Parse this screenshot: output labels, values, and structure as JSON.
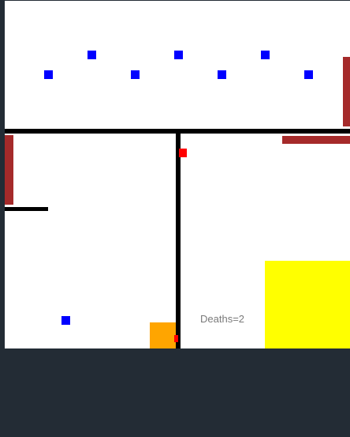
{
  "game": {
    "deaths_text": "Deaths=2",
    "deaths": 2
  },
  "colors": {
    "background_frame": "#232c35",
    "playfield": "#ffffff",
    "wall": "#000000",
    "hazard_bar": "#a52a2a",
    "enemy": "#0000ff",
    "player": "#ff0000",
    "pusher_block": "#ffa500",
    "goal_zone": "#ffff00"
  }
}
